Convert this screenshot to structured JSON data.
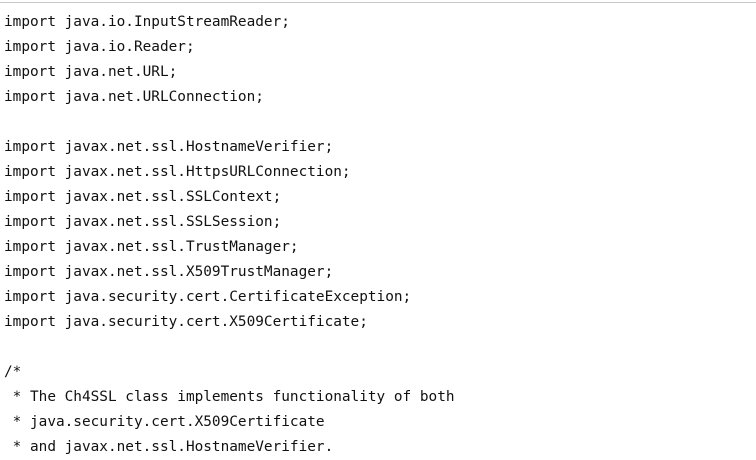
{
  "code_lines": [
    "import java.io.InputStreamReader;",
    "import java.io.Reader;",
    "import java.net.URL;",
    "import java.net.URLConnection;",
    "",
    "import javax.net.ssl.HostnameVerifier;",
    "import javax.net.ssl.HttpsURLConnection;",
    "import javax.net.ssl.SSLContext;",
    "import javax.net.ssl.SSLSession;",
    "import javax.net.ssl.TrustManager;",
    "import javax.net.ssl.X509TrustManager;",
    "import java.security.cert.CertificateException;",
    "import java.security.cert.X509Certificate;",
    "",
    "/*",
    " * The Ch4SSL class implements functionality of both",
    " * java.security.cert.X509Certificate",
    " * and javax.net.ssl.HostnameVerifier."
  ]
}
